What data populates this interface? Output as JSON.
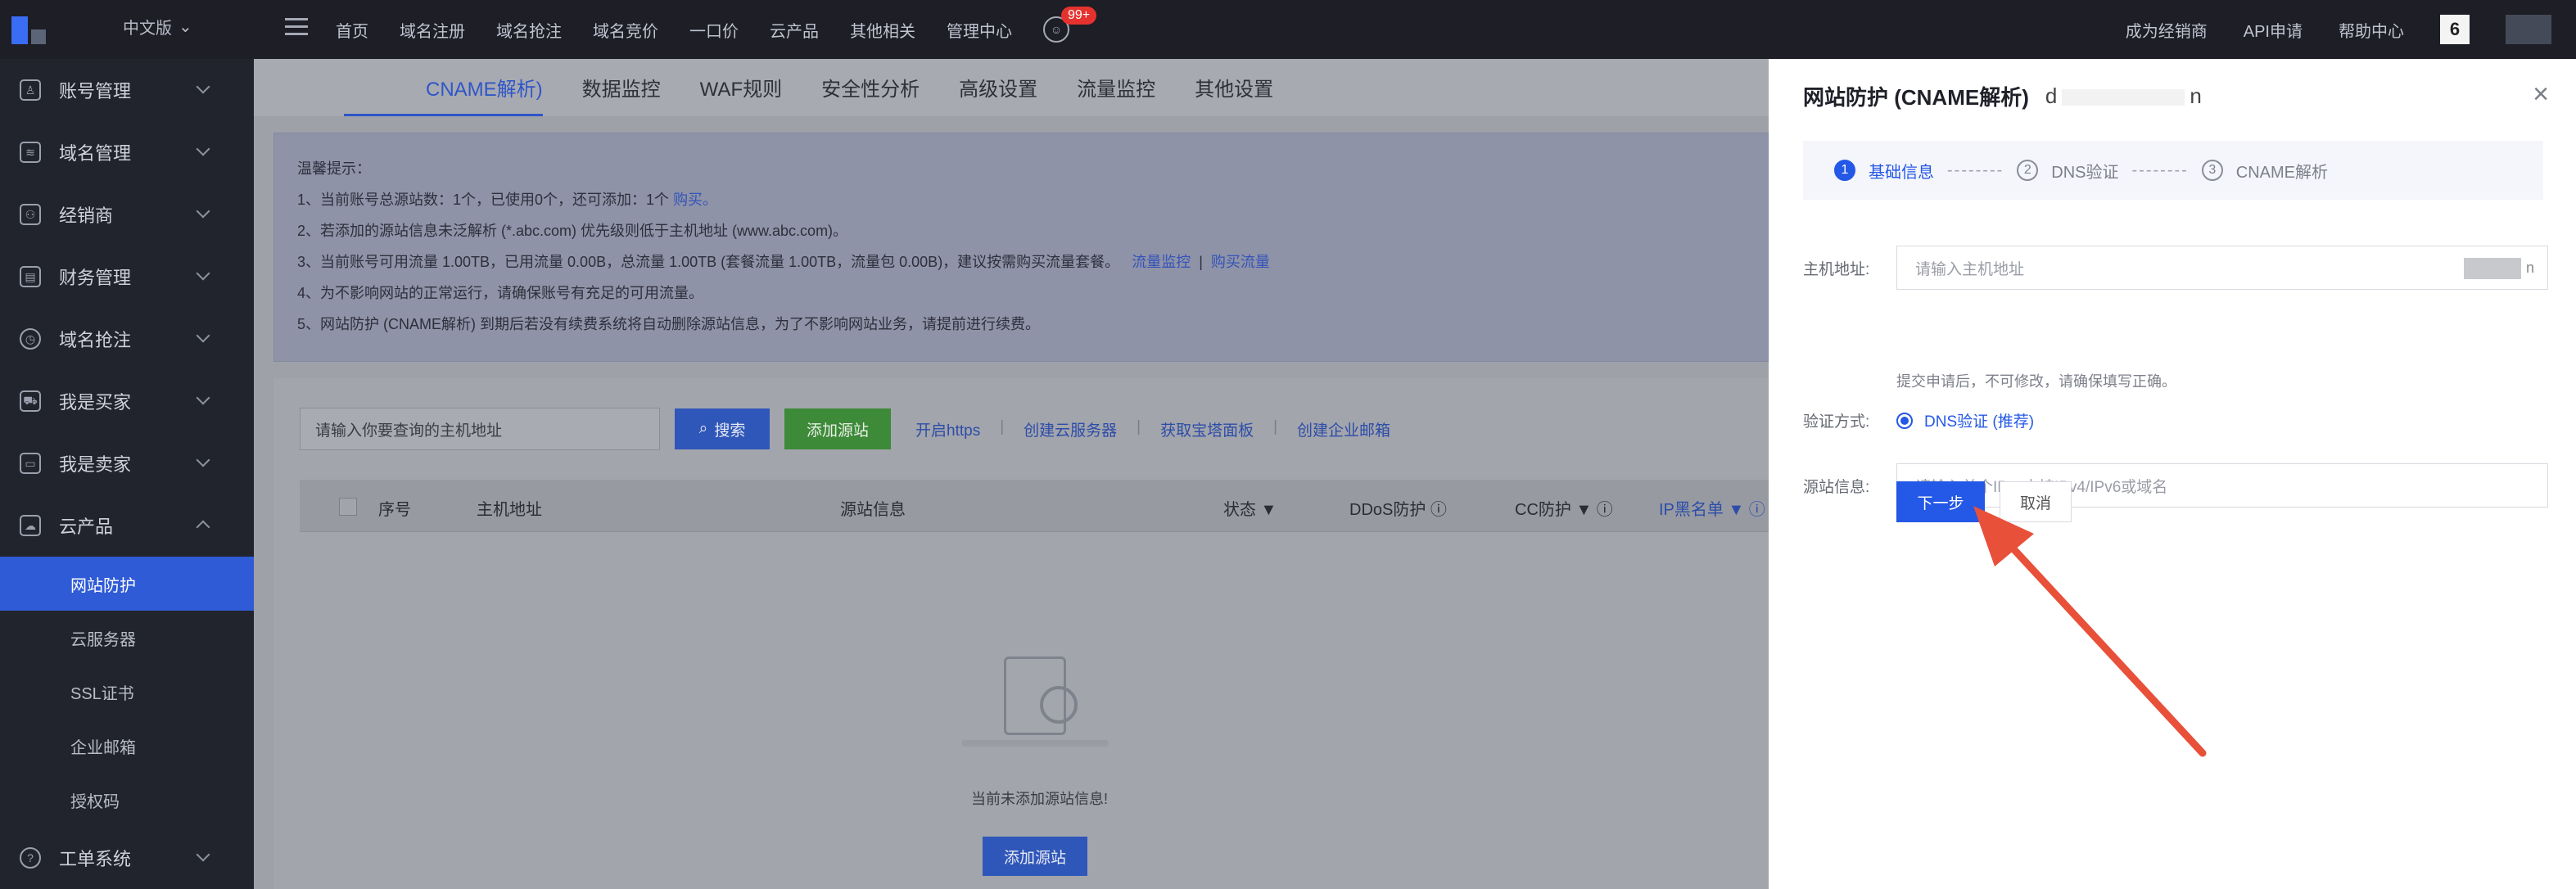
{
  "topbar": {
    "lang": "中文版",
    "nav": [
      "首页",
      "域名注册",
      "域名抢注",
      "域名竞价",
      "一口价",
      "云产品",
      "其他相关",
      "管理中心"
    ],
    "badge": "99+",
    "right": [
      "成为经销商",
      "API申请",
      "帮助中心"
    ],
    "avatar_text": "6"
  },
  "sidebar": {
    "items": [
      {
        "label": "账号管理",
        "icon": "user-icon"
      },
      {
        "label": "域名管理",
        "icon": "layers-icon"
      },
      {
        "label": "经销商",
        "icon": "users-icon"
      },
      {
        "label": "财务管理",
        "icon": "finance-icon"
      },
      {
        "label": "域名抢注",
        "icon": "clock-icon"
      },
      {
        "label": "我是买家",
        "icon": "cart-icon"
      },
      {
        "label": "我是卖家",
        "icon": "store-icon"
      },
      {
        "label": "云产品",
        "icon": "cloud-icon"
      }
    ],
    "sub_items": [
      "网站防护",
      "云服务器",
      "SSL证书",
      "企业邮箱",
      "授权码"
    ],
    "bottom_item": {
      "label": "工单系统",
      "icon": "help-icon"
    }
  },
  "main": {
    "tabs": [
      "CNAME解析)",
      "数据监控",
      "WAF规则",
      "安全性分析",
      "高级设置",
      "流量监控",
      "其他设置"
    ],
    "notice": {
      "title": "温馨提示：",
      "lines": [
        "1、当前账号总源站数：1个，已使用0个，还可添加：1个",
        "2、若添加的源站信息未泛解析 (*.abc.com) 优先级则低于主机地址 (www.abc.com)。",
        "3、当前账号可用流量 1.00TB，已用流量 0.00B，总流量 1.00TB (套餐流量 1.00TB，流量包 0.00B)，建议按需购买流量套餐。",
        "4、为不影响网站的正常运行，请确保账号有充足的可用流量。",
        "5、网站防护 (CNAME解析) 到期后若没有续费系统将自动删除源站信息，为了不影响网站业务，请提前进行续费。"
      ],
      "buy_link": "购买。",
      "link_monitor": "流量监控",
      "link_sep": "|",
      "link_buy_traffic": "购买流量"
    },
    "search_placeholder": "请输入你要查询的主机地址",
    "search_btn": "搜索",
    "add_btn": "添加源站",
    "links": [
      "开启https",
      "创建云服务器",
      "获取宝塔面板",
      "创建企业邮箱"
    ],
    "table_headers": [
      "序号",
      "主机地址",
      "源站信息",
      "状态 ▼",
      "DDoS防护 ⓘ",
      "CC防护 ▼ ⓘ",
      "IP黑名单 ▼ ⓘ"
    ],
    "empty_text": "当前未添加源站信息!",
    "empty_btn": "添加源站"
  },
  "drawer": {
    "title": "网站防护 (CNAME解析)",
    "host_prefix": "d",
    "host_suffix": "n",
    "close": "×",
    "steps": [
      {
        "num": "1",
        "label": "基础信息"
      },
      {
        "num": "2",
        "label": "DNS验证"
      },
      {
        "num": "3",
        "label": "CNAME解析"
      }
    ],
    "step_dashes": "--------",
    "host_label": "主机地址:",
    "host_placeholder": "请输入主机地址",
    "host_hint": "提交申请后，不可修改，请确保填写正确。",
    "verify_label": "验证方式:",
    "verify_option": "DNS验证 (推荐)",
    "source_label": "源站信息:",
    "source_placeholder": "请输入单个IP，支持IPv4/IPv6或域名",
    "next_btn": "下一步",
    "cancel_btn": "取消"
  },
  "colors": {
    "primary": "#2458e6",
    "arrow": "#e8503a",
    "sidebar_active": "#2f5bd6",
    "badge": "#e5322f"
  }
}
